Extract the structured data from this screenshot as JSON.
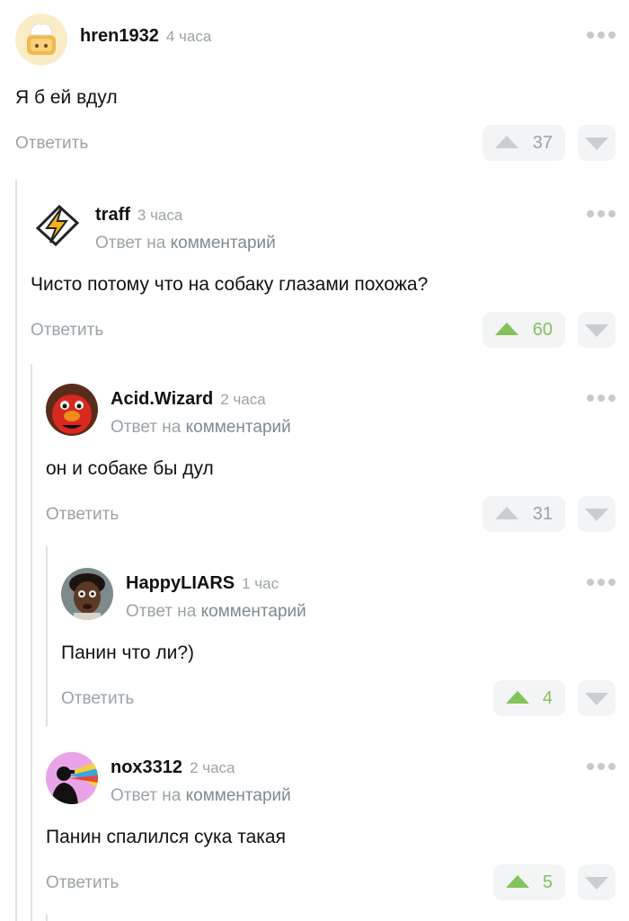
{
  "reply_label": "Ответить",
  "reply_to_prefix": "Ответ на",
  "reply_to_link": "комментарий",
  "colors": {
    "vote_active": "#85c25a",
    "vote_neutral": "#c9ced1",
    "muted_text": "#9aa3a8"
  },
  "comments": [
    {
      "user": "hren1932",
      "time": "4 часа",
      "text": "Я б ей вдул",
      "votes": "37",
      "vote_active": false,
      "is_reply": false,
      "avatar": "chef-bread-avatar"
    },
    {
      "user": "traff",
      "time": "3 часа",
      "text": "Чисто потому что на собаку глазами похожа?",
      "votes": "60",
      "vote_active": true,
      "is_reply": true,
      "avatar": "winamp-bolt-avatar"
    },
    {
      "user": "Acid.Wizard",
      "time": "2 часа",
      "text": "он и собаке бы дул",
      "votes": "31",
      "vote_active": false,
      "is_reply": true,
      "avatar": "red-puppet-avatar"
    },
    {
      "user": "HappyLIARS",
      "time": "1 час",
      "text": "Панин что ли?)",
      "votes": "4",
      "vote_active": true,
      "is_reply": true,
      "avatar": "man-face-avatar"
    },
    {
      "user": "nox3312",
      "time": "2 часа",
      "text": "Панин спалился сука такая",
      "votes": "5",
      "vote_active": true,
      "is_reply": true,
      "avatar": "rainbow-silhouette-avatar"
    }
  ]
}
